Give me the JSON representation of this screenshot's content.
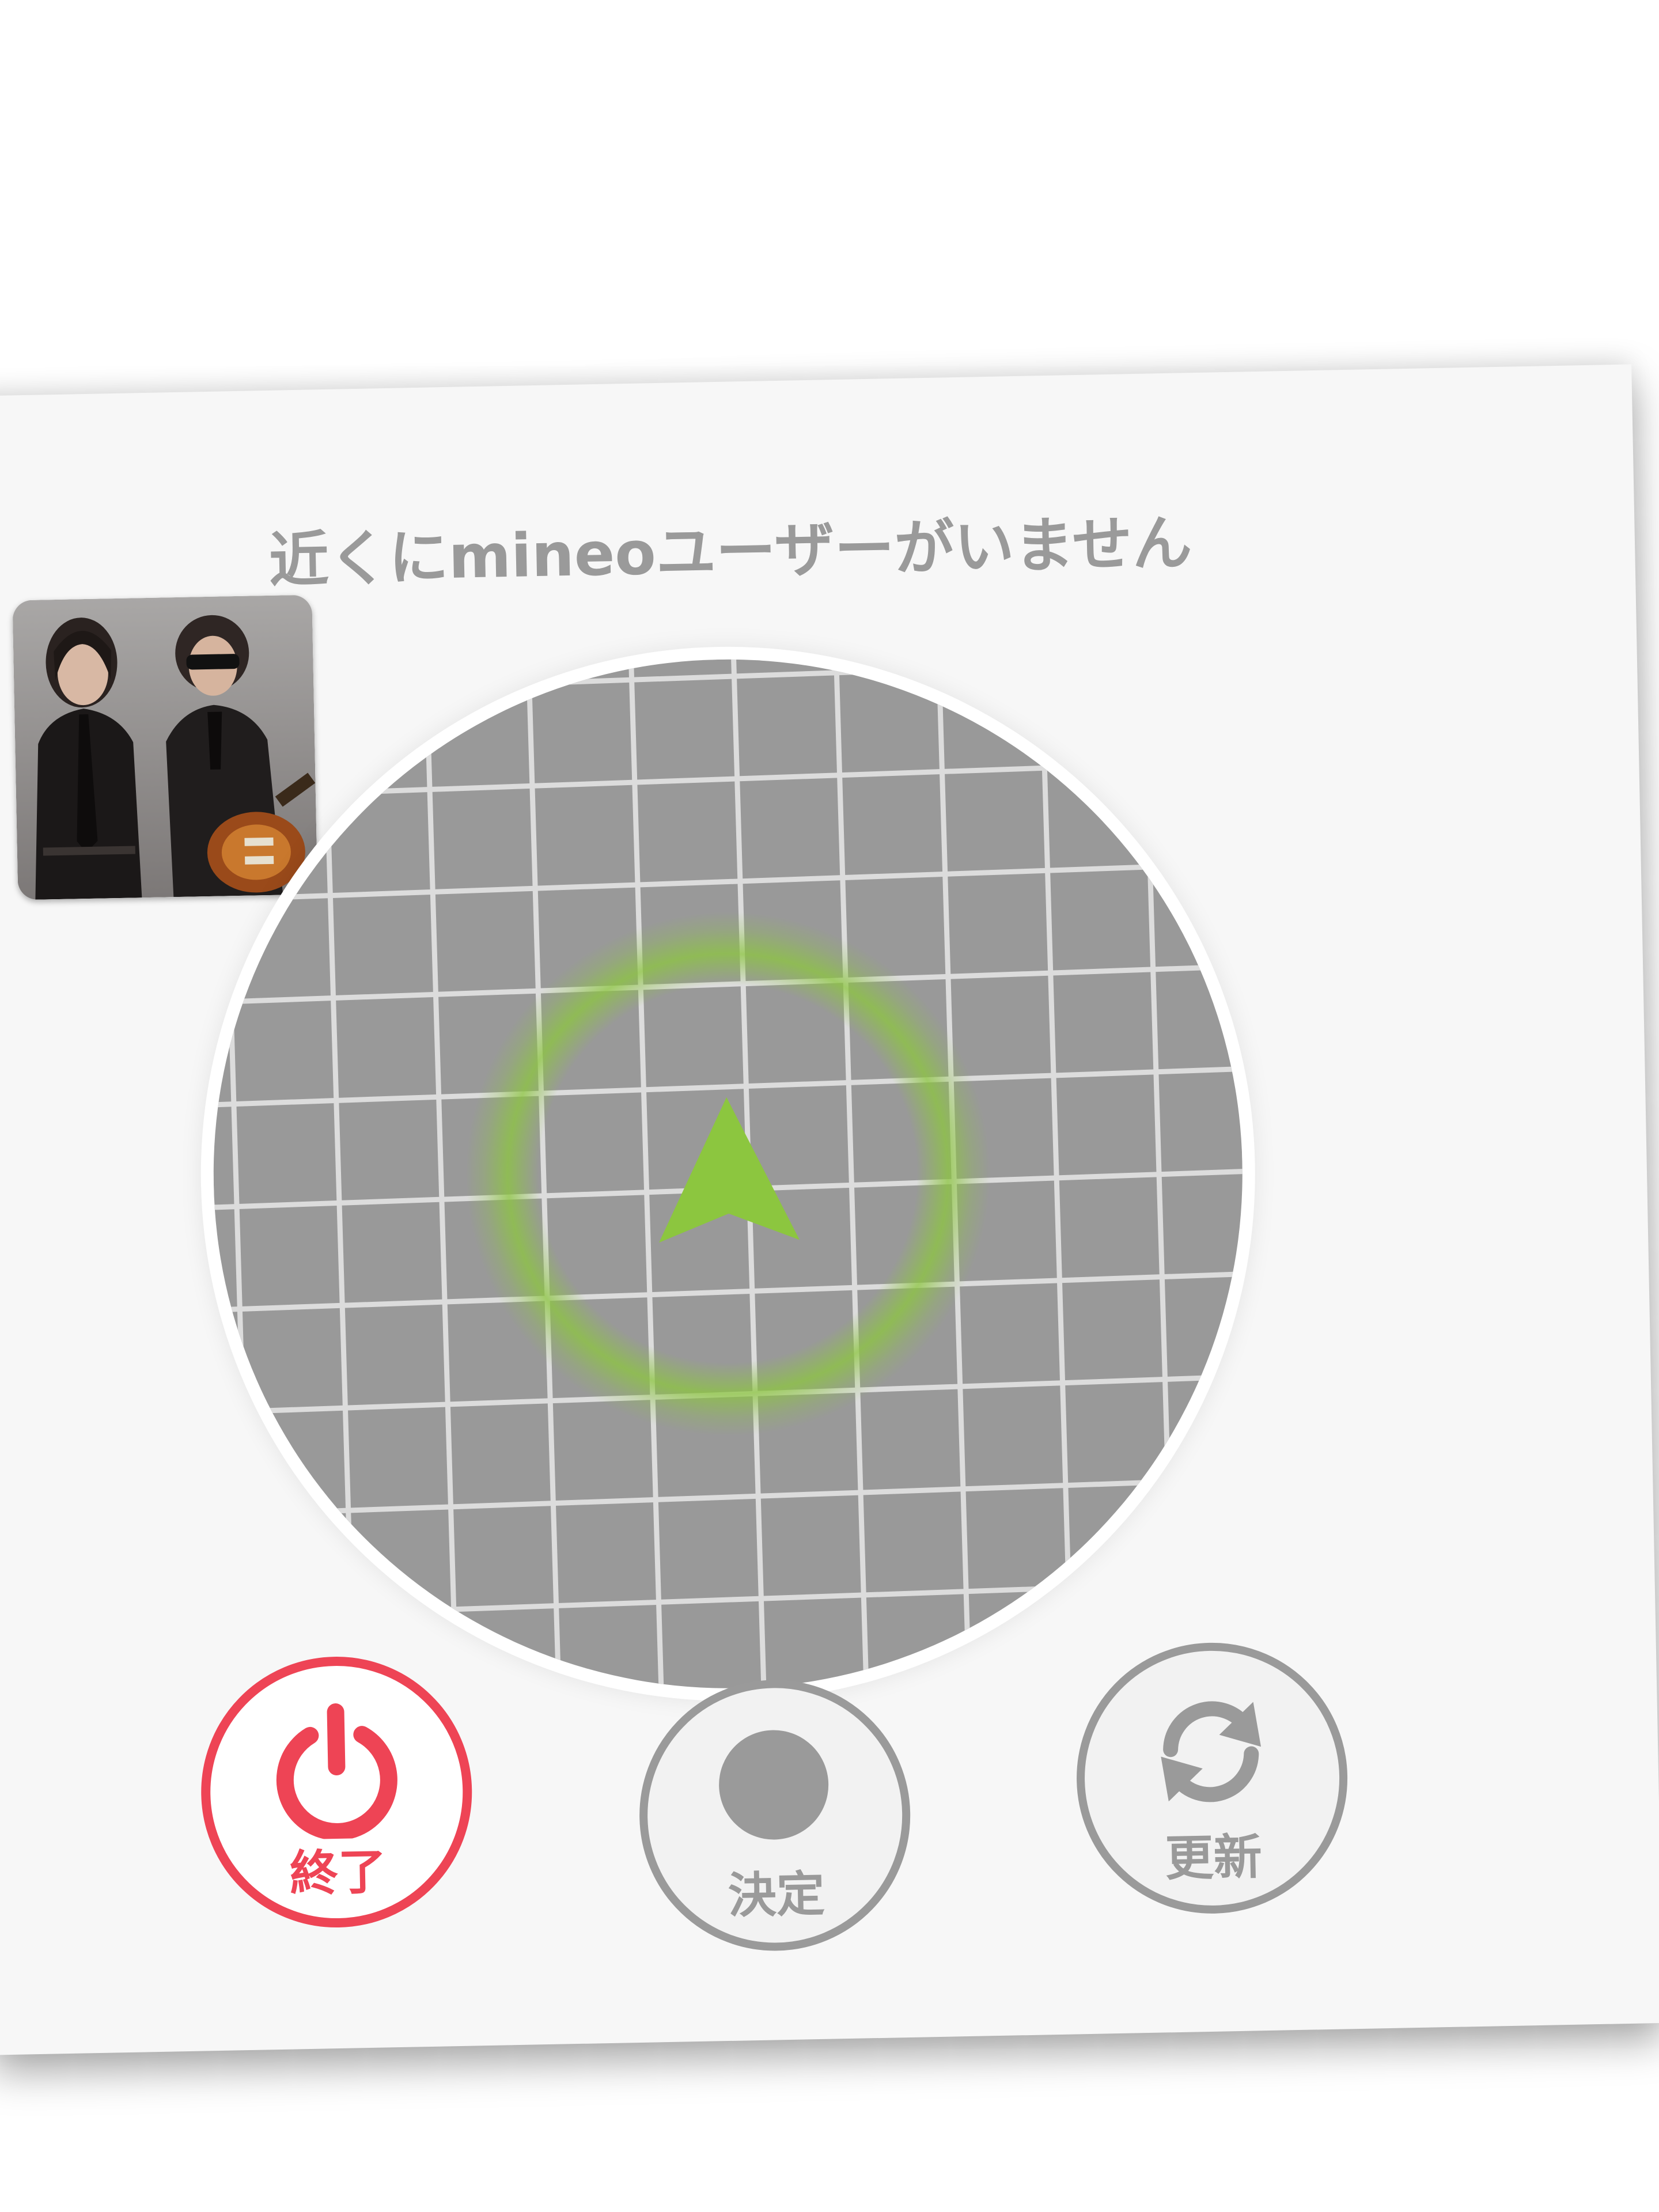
{
  "status": {
    "message": "近くにmineoユーザーがいません"
  },
  "profile": {
    "image_name": "user-photo"
  },
  "radar": {
    "ring_color": "#8cc63f",
    "arrow_color": "#8cc63f",
    "grid_background": "#999999",
    "grid_line_color": "#dcdcdc"
  },
  "buttons": {
    "exit_label": "終了",
    "decide_label": "決定",
    "refresh_label": "更新",
    "exit_color": "#ee4455",
    "neutral_color": "#9a9a9a"
  },
  "icons": {
    "exit": "power-icon",
    "decide": "record-dot-icon",
    "refresh": "refresh-icon",
    "position": "direction-arrow-icon"
  }
}
